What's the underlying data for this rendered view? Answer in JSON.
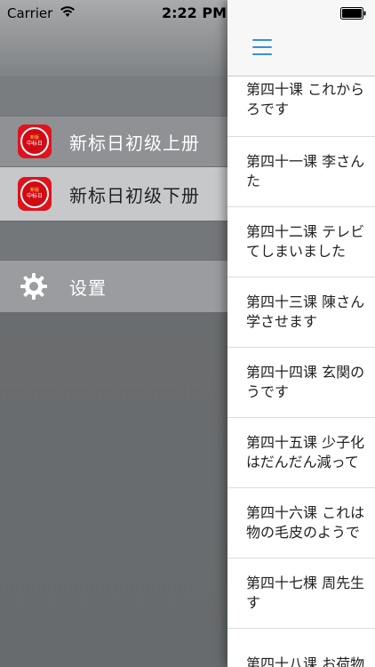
{
  "status_bar": {
    "carrier": "Carrier",
    "time": "2:22 PM"
  },
  "drawer": {
    "items": [
      {
        "label": "新标日初级上册",
        "icon_text_top": "新版",
        "icon_text_main": "中标日"
      },
      {
        "label": "新标日初级下册",
        "icon_text_top": "新版",
        "icon_text_main": "中标日"
      }
    ],
    "settings_label": "设置"
  },
  "main": {
    "lessons": [
      {
        "line1": "第四十课 これから",
        "line2": "ろです"
      },
      {
        "line1": "第四十一课 李さん",
        "line2": "た"
      },
      {
        "line1": "第四十二课 テレビ",
        "line2": "てしまいました"
      },
      {
        "line1": "第四十三课 陳さん",
        "line2": "学させます"
      },
      {
        "line1": "第四十四课 玄関の",
        "line2": "うです"
      },
      {
        "line1": "第四十五课 少子化",
        "line2": "はだんだん減って"
      },
      {
        "line1": "第四十六课 これは",
        "line2": "物の毛皮のようで"
      },
      {
        "line1": "第四十七棵 周先生",
        "line2": "す"
      },
      {
        "line1": "第四十八课 お荷物",
        "line2": ""
      }
    ]
  },
  "colors": {
    "accent": "#3a8fd8",
    "icon_red": "#e1121c"
  }
}
